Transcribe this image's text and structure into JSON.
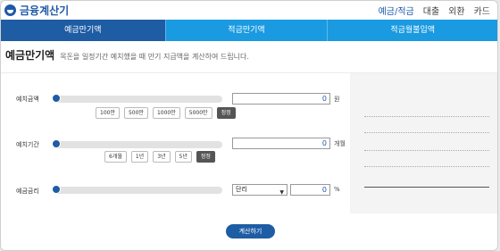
{
  "header": {
    "logo_text": "금융계산기",
    "nav": [
      "예금/적금",
      "대출",
      "외환",
      "카드"
    ]
  },
  "tabs": [
    "예금만기액",
    "적금만기액",
    "적금월불입액"
  ],
  "page": {
    "title": "예금만기액",
    "description": "목돈을 일정기간 예치했을 때 만기 지급액을 계산하여 드립니다."
  },
  "deposit": {
    "label": "예치금액",
    "chips": [
      "100만",
      "500만",
      "1000만",
      "5000만"
    ],
    "reset": "정정",
    "value": "0",
    "unit": "원",
    "slider_fraction": 0
  },
  "period": {
    "label": "예치기간",
    "chips": [
      "6개월",
      "1년",
      "3년",
      "5년"
    ],
    "reset": "정정",
    "value": "0",
    "unit": "개월",
    "slider_fraction": 0
  },
  "rate": {
    "label": "예금금리",
    "interest_type": "단리",
    "value": "0",
    "unit": "%",
    "slider_fraction": 0
  },
  "calculate_label": "계산하기",
  "colors": {
    "primary": "#1e5ca4",
    "tab": "#1a9ae0"
  }
}
